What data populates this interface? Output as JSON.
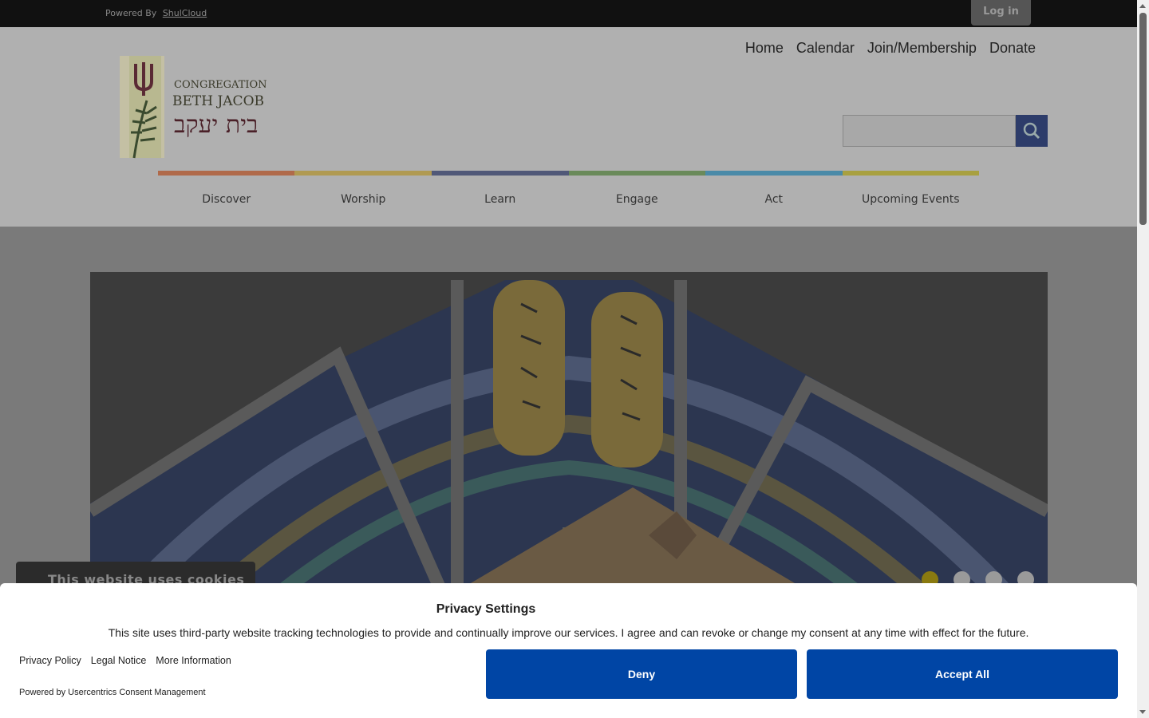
{
  "topbar": {
    "powered_prefix": "Powered By",
    "powered_link": "ShulCloud",
    "login_label": "Log in"
  },
  "topnav": [
    "Home",
    "Calendar",
    "Join/Membership",
    "Donate"
  ],
  "logo": {
    "line1": "CONGREGATION",
    "line2": "BETH JACOB",
    "hebrew": "בית יעקב"
  },
  "search": {
    "icon": "search-icon",
    "placeholder": ""
  },
  "mainnav": [
    "Discover",
    "Worship",
    "Learn",
    "Engage",
    "Act",
    "Upcoming Events"
  ],
  "nav_colors": [
    "#b06a4a",
    "#b09a52",
    "#505878",
    "#6a8a5a",
    "#4a8aa8",
    "#a8a040"
  ],
  "hero": {
    "slide_count": 4,
    "active_slide": 1
  },
  "cookie_tab": {
    "label": "This website uses cookies"
  },
  "privacy": {
    "title": "Privacy Settings",
    "text": "This site uses third-party website tracking technologies to provide and continually improve our services. I agree and can revoke or change my consent at any time with effect for the future.",
    "links": [
      "Privacy Policy",
      "Legal Notice",
      "More Information"
    ],
    "powered": "Powered by Usercentrics Consent Management",
    "deny_label": "Deny",
    "accept_label": "Accept All",
    "button_color": "#0045a5"
  }
}
